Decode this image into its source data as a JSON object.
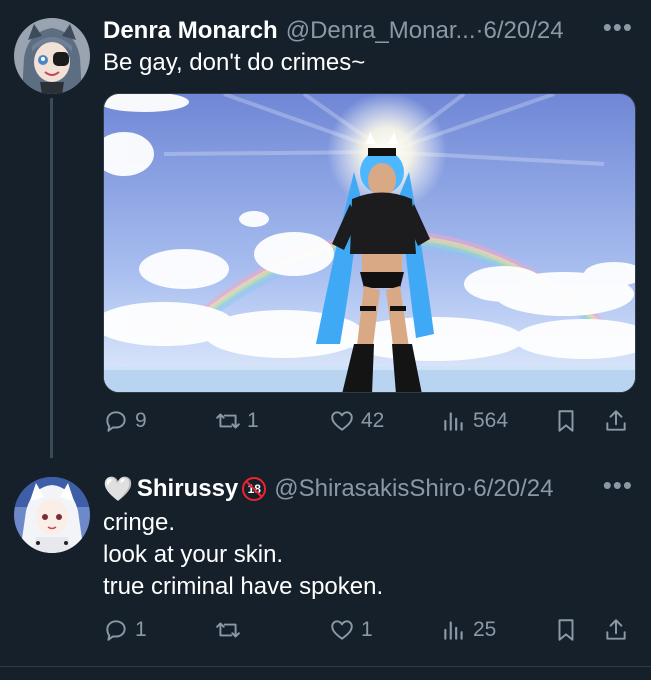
{
  "tweets": [
    {
      "author_name": "Denra Monarch",
      "handle": "@Denra_Monar...",
      "separator": "·",
      "date": "6/20/24",
      "text": "Be gay, don't do crimes~",
      "stats": {
        "replies": "9",
        "retweets": "1",
        "likes": "42",
        "views": "564"
      }
    },
    {
      "author_name": "Shirussy",
      "name_prefix_emoji": "🤍",
      "name_badge": "18",
      "handle": "@ShirasakisShiro",
      "separator": "·",
      "date": "6/20/24",
      "text_lines": [
        "cringe.",
        "look at your skin.",
        "true criminal have spoken."
      ],
      "stats": {
        "replies": "1",
        "retweets": "",
        "likes": "1",
        "views": "25"
      }
    }
  ],
  "more_glyph": "•••",
  "colors": {
    "background": "#15202b",
    "muted": "#8b98a5",
    "thread_line": "#3b4a57",
    "badge_red": "#f4212e"
  }
}
